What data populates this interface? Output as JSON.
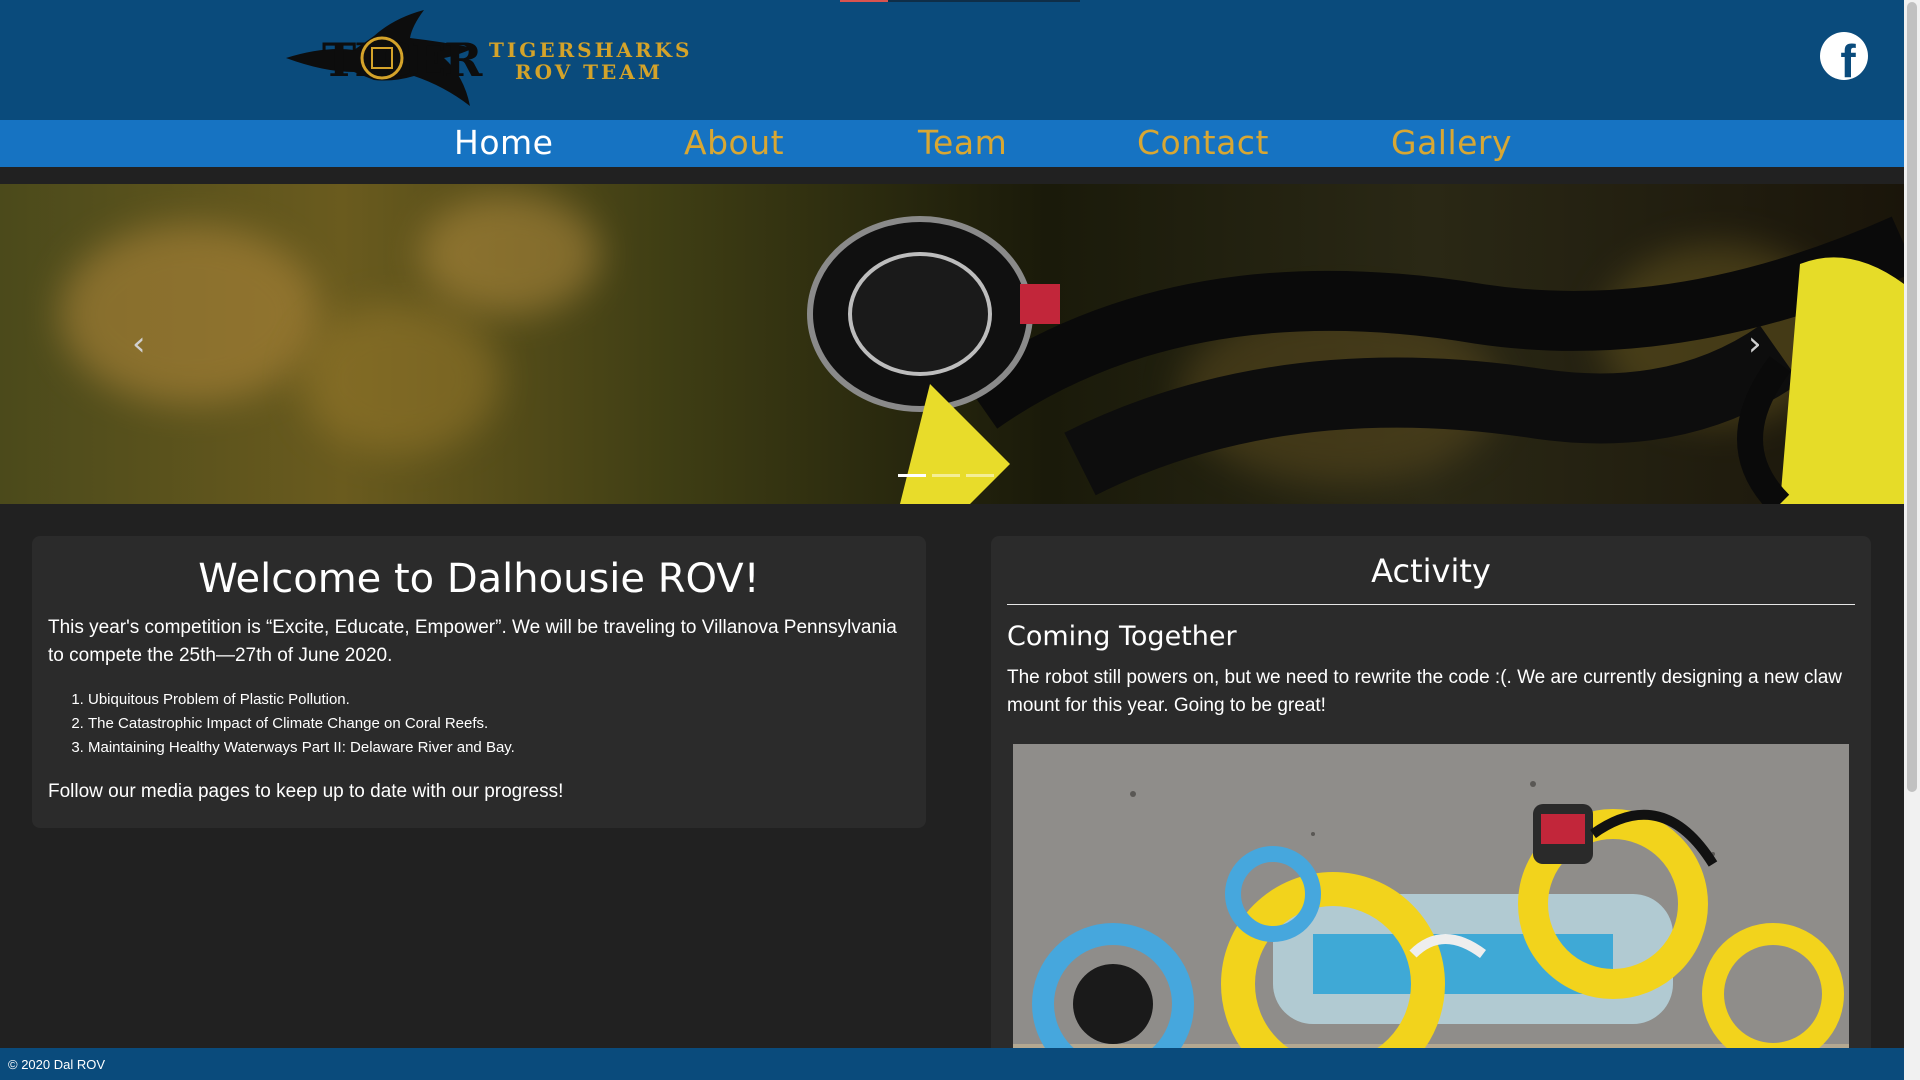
{
  "header": {
    "logo_line1": "TIGERSHARKS",
    "logo_line2": "ROV TEAM",
    "facebook_icon": "facebook-icon",
    "facebook_glyph": "f"
  },
  "nav": {
    "items": [
      {
        "label": "Home",
        "active": true
      },
      {
        "label": "About"
      },
      {
        "label": "Team"
      },
      {
        "label": "Contact"
      },
      {
        "label": "Gallery"
      }
    ]
  },
  "carousel": {
    "prev_glyph": "‹",
    "next_glyph": "›",
    "slide_count": 3,
    "active_slide": 1
  },
  "welcome": {
    "title": "Welcome to Dalhousie ROV!",
    "intro": "This year's competition is “Excite, Educate, Empower”. We will be traveling to Villanova Pennsylvania to compete the 25th—27th of June 2020.",
    "topics": [
      "Ubiquitous Problem of Plastic Pollution.",
      "The Catastrophic Impact of Climate Change on Coral Reefs.",
      "Maintaining Healthy Waterways Part II: Delaware River and Bay."
    ],
    "follow": "Follow our media pages to keep up to date with our progress!"
  },
  "activity": {
    "title": "Activity",
    "post_title": "Coming Together",
    "post_body": "The robot still powers on, but we need to rewrite the code :(. We are currently designing a new claw mount for this year. Going to be great!"
  },
  "footer": {
    "copyright": "© 2020 Dal ROV"
  },
  "colors": {
    "header_bg": "#0a4b7c",
    "nav_bg": "#1673c2",
    "nav_link": "#d8a733",
    "page_bg": "#212121",
    "card_bg": "#2b2b2b"
  }
}
